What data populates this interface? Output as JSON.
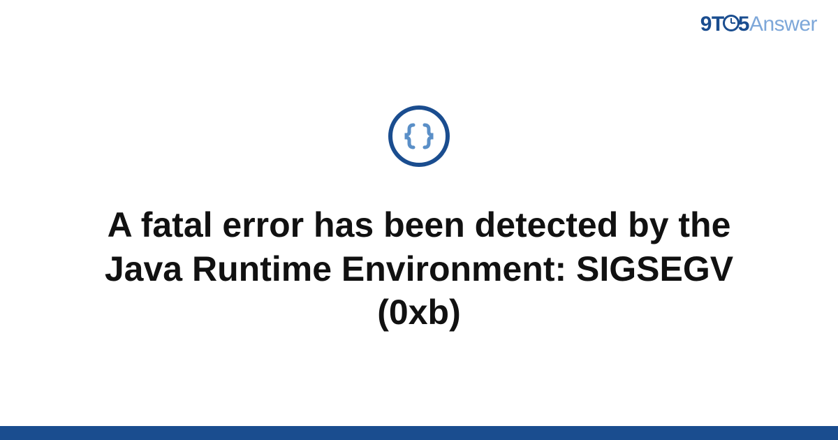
{
  "brand": {
    "part1": "9T",
    "part2": "5",
    "part3": "Answer"
  },
  "icon": {
    "name": "code-braces"
  },
  "title": "A fatal error has been detected by the Java Runtime Environment: SIGSEGV (0xb)",
  "colors": {
    "primary": "#1a4d8f",
    "secondary": "#7da7d9",
    "iconBrace": "#5a8fc7"
  }
}
